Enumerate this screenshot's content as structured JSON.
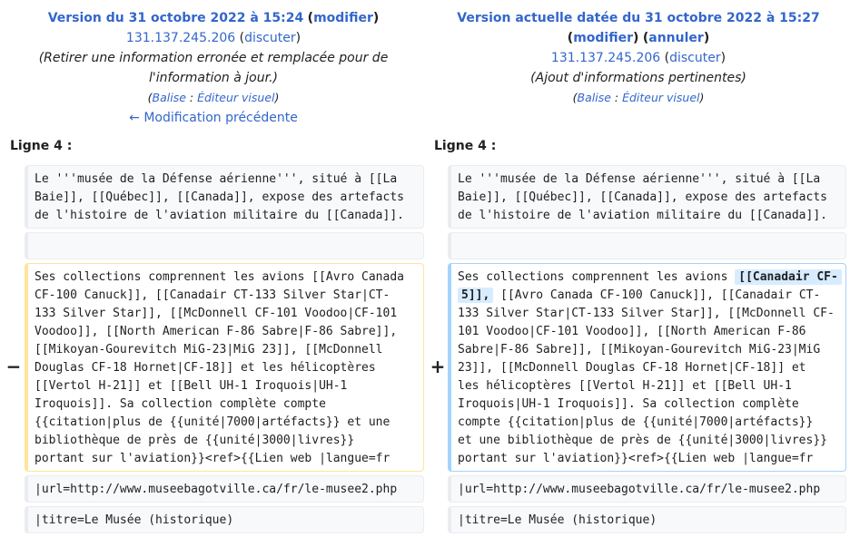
{
  "left_header": {
    "title": "Version du 31 octobre 2022 à 15:24",
    "modify": "modifier",
    "user": "131.137.245.206",
    "talk": "discuter",
    "summary": "(Retirer une information erronée et remplacée pour de l'information à jour.)",
    "tag_label": "Balise",
    "tag_value": "Éditeur visuel",
    "prev_link": "← Modification précédente"
  },
  "right_header": {
    "title": "Version actuelle datée du 31 octobre 2022 à 15:27",
    "modify": "modifier",
    "undo": "annuler",
    "user": "131.137.245.206",
    "talk": "discuter",
    "summary": "(Ajout d'informations pertinentes)",
    "tag_label": "Balise",
    "tag_value": "Éditeur visuel"
  },
  "line_label": "Ligne 4 :",
  "markers": {
    "minus": "−",
    "plus": "+"
  },
  "left_lines": {
    "context1": [
      "Le '''musée de la Défense aérienne''', situé à [[La",
      "Baie]], [[Québec]], [[Canada]], expose des artefacts",
      "de l'histoire de l'aviation militaire du [[Canada]]."
    ],
    "deleted": [
      "Ses collections comprennent les avions [[Avro Canada",
      "CF-100 Canuck]], [[Canadair CT-133 Silver Star|CT-",
      "133 Silver Star]], [[McDonnell CF-101 Voodoo|CF-101",
      "Voodoo]], [[North American F-86 Sabre|F-86 Sabre]],",
      "[[Mikoyan-Gourevitch MiG-23|MiG 23]], [[McDonnell",
      "Douglas CF-18 Hornet|CF-18]] et les hélicoptères",
      "[[Vertol H-21]] et [[Bell UH-1 Iroquois|UH-1",
      "Iroquois]]. Sa collection complète compte",
      "{{citation|plus de {{unité|7000|artéfacts}} et une",
      "bibliothèque de près de {{unité|3000|livres}}",
      "portant sur l'aviation}}<ref>{{Lien web |langue=fr"
    ],
    "url": "|url=http://www.museebagotville.ca/fr/le-musee2.php",
    "titre": "|titre=Le Musée (historique)"
  },
  "right_lines": {
    "context1": [
      "Le '''musée de la Défense aérienne''', situé à [[La",
      "Baie]], [[Québec]], [[Canada]], expose des artefacts",
      "de l'histoire de l'aviation militaire du [[Canada]]."
    ],
    "added_first_prefix": "Ses collections comprennent les avions ",
    "added_insert_1": "[[Canadair CF-",
    "added_insert_2": "5]],",
    "added_line2_rest": " [[Avro Canada CF-100 Canuck]], [[Canadair CT-",
    "added_rest": [
      "133 Silver Star|CT-133 Silver Star]], [[McDonnell CF-",
      "101 Voodoo|CF-101 Voodoo]], [[North American F-86",
      "Sabre|F-86 Sabre]], [[Mikoyan-Gourevitch MiG-23|MiG",
      "23]], [[McDonnell Douglas CF-18 Hornet|CF-18]] et",
      "les hélicoptères [[Vertol H-21]] et [[Bell UH-1",
      "Iroquois|UH-1 Iroquois]]. Sa collection complète",
      "compte {{citation|plus de {{unité|7000|artéfacts}}",
      "et une bibliothèque de près de {{unité|3000|livres}}",
      "portant sur l'aviation}}<ref>{{Lien web |langue=fr"
    ],
    "url": "|url=http://www.museebagotville.ca/fr/le-musee2.php",
    "titre": "|titre=Le Musée (historique)"
  }
}
